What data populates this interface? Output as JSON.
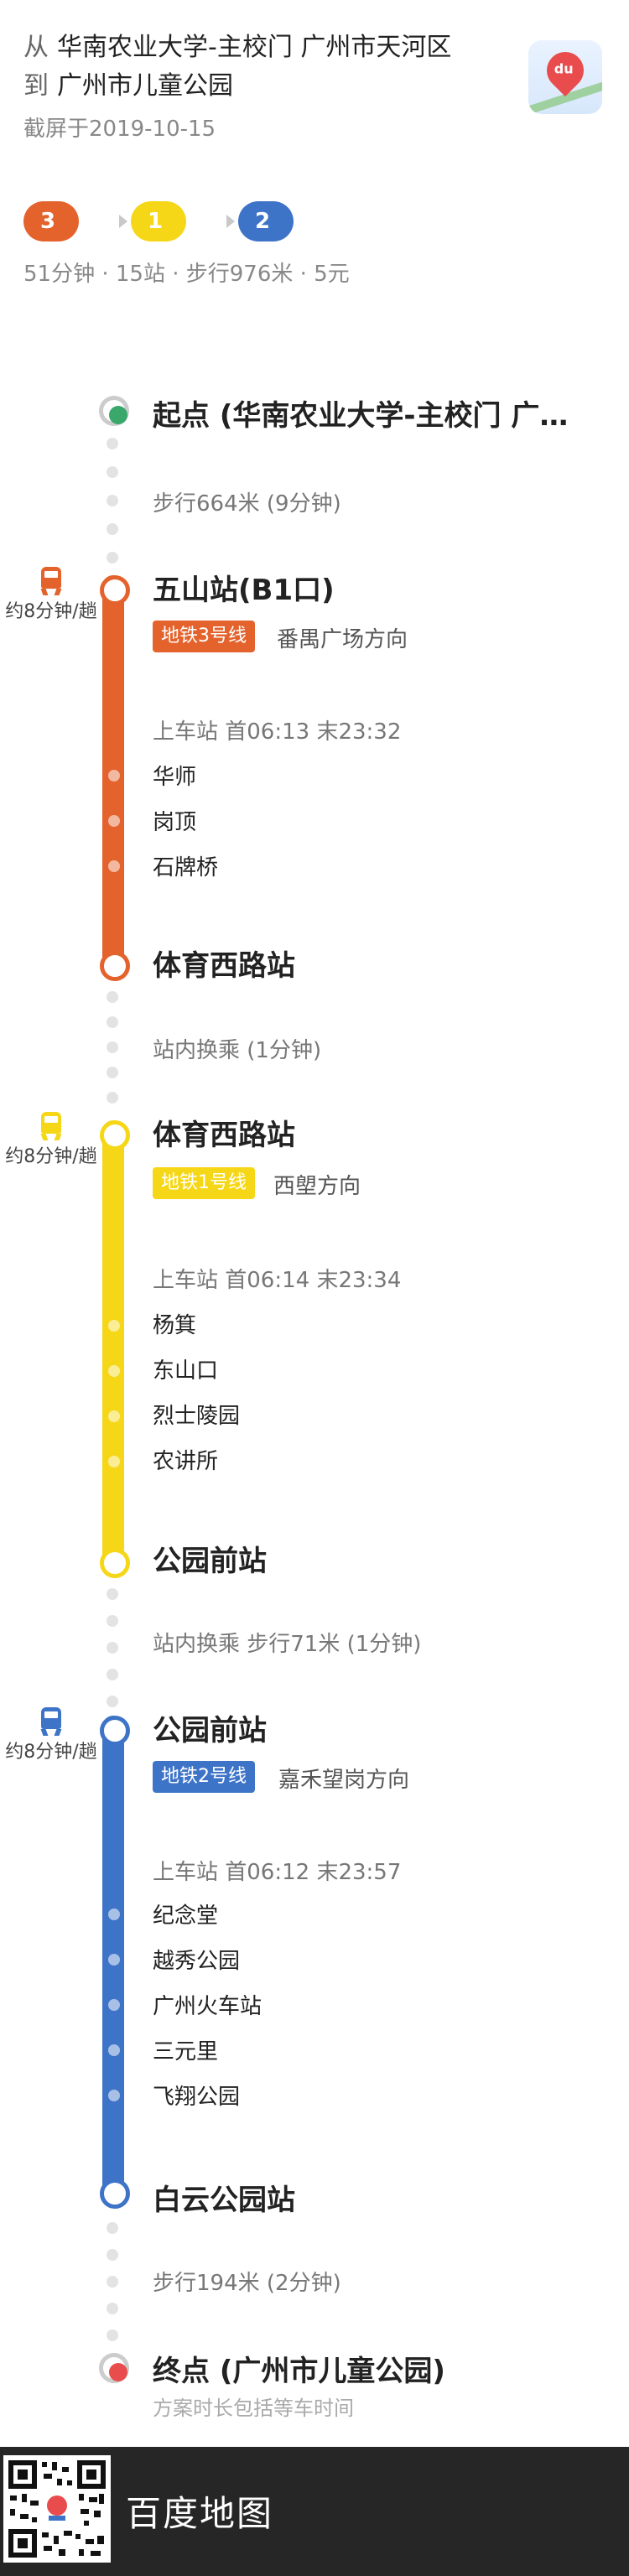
{
  "header": {
    "from_prefix": "从",
    "from_text": "华南农业大学-主校门 广州市天河区",
    "to_prefix": "到",
    "to_text": "广州市儿童公园",
    "screenshot_date": "截屏于2019-10-15"
  },
  "route_chips": [
    {
      "label": "3号线",
      "color": "#e4632d"
    },
    {
      "label": "1号线",
      "color": "#f6d718"
    },
    {
      "label": "2号线",
      "color": "#3e74c8"
    }
  ],
  "summary": "51分钟 · 15站 · 步行976米 · 5元",
  "start": {
    "label": "起点 (华南农业大学-主校门 广…"
  },
  "walk1": "步行664米 (9分钟)",
  "segments": [
    {
      "line_color": "#e4632d",
      "freq": "约8分钟/趟",
      "board_station": "五山站(B1口)",
      "badge": "地铁3号线",
      "direction": "番禺广场方向",
      "hours": "上车站 首06:13 末23:32",
      "stops": [
        "华师",
        "岗顶",
        "石牌桥"
      ],
      "alight_station": "体育西路站"
    },
    {
      "line_color": "#f6d718",
      "freq": "约8分钟/趟",
      "board_station": "体育西路站",
      "badge": "地铁1号线",
      "direction": "西塱方向",
      "hours": "上车站 首06:14 末23:34",
      "stops": [
        "杨箕",
        "东山口",
        "烈士陵园",
        "农讲所"
      ],
      "alight_station": "公园前站"
    },
    {
      "line_color": "#3e74c8",
      "freq": "约8分钟/趟",
      "board_station": "公园前站",
      "badge": "地铁2号线",
      "direction": "嘉禾望岗方向",
      "hours": "上车站 首06:12 末23:57",
      "stops": [
        "纪念堂",
        "越秀公园",
        "广州火车站",
        "三元里",
        "飞翔公园"
      ],
      "alight_station": "白云公园站"
    }
  ],
  "transfer1": "站内换乘 (1分钟)",
  "transfer2": "站内换乘 步行71米 (1分钟)",
  "walk2": "步行194米 (2分钟)",
  "end": {
    "label": "终点 (广州市儿童公园)",
    "note": "方案时长包括等车时间"
  },
  "footer": {
    "app_name": "百度地图"
  },
  "colors": {
    "start": "#3aa86b",
    "end": "#e84c4c"
  }
}
